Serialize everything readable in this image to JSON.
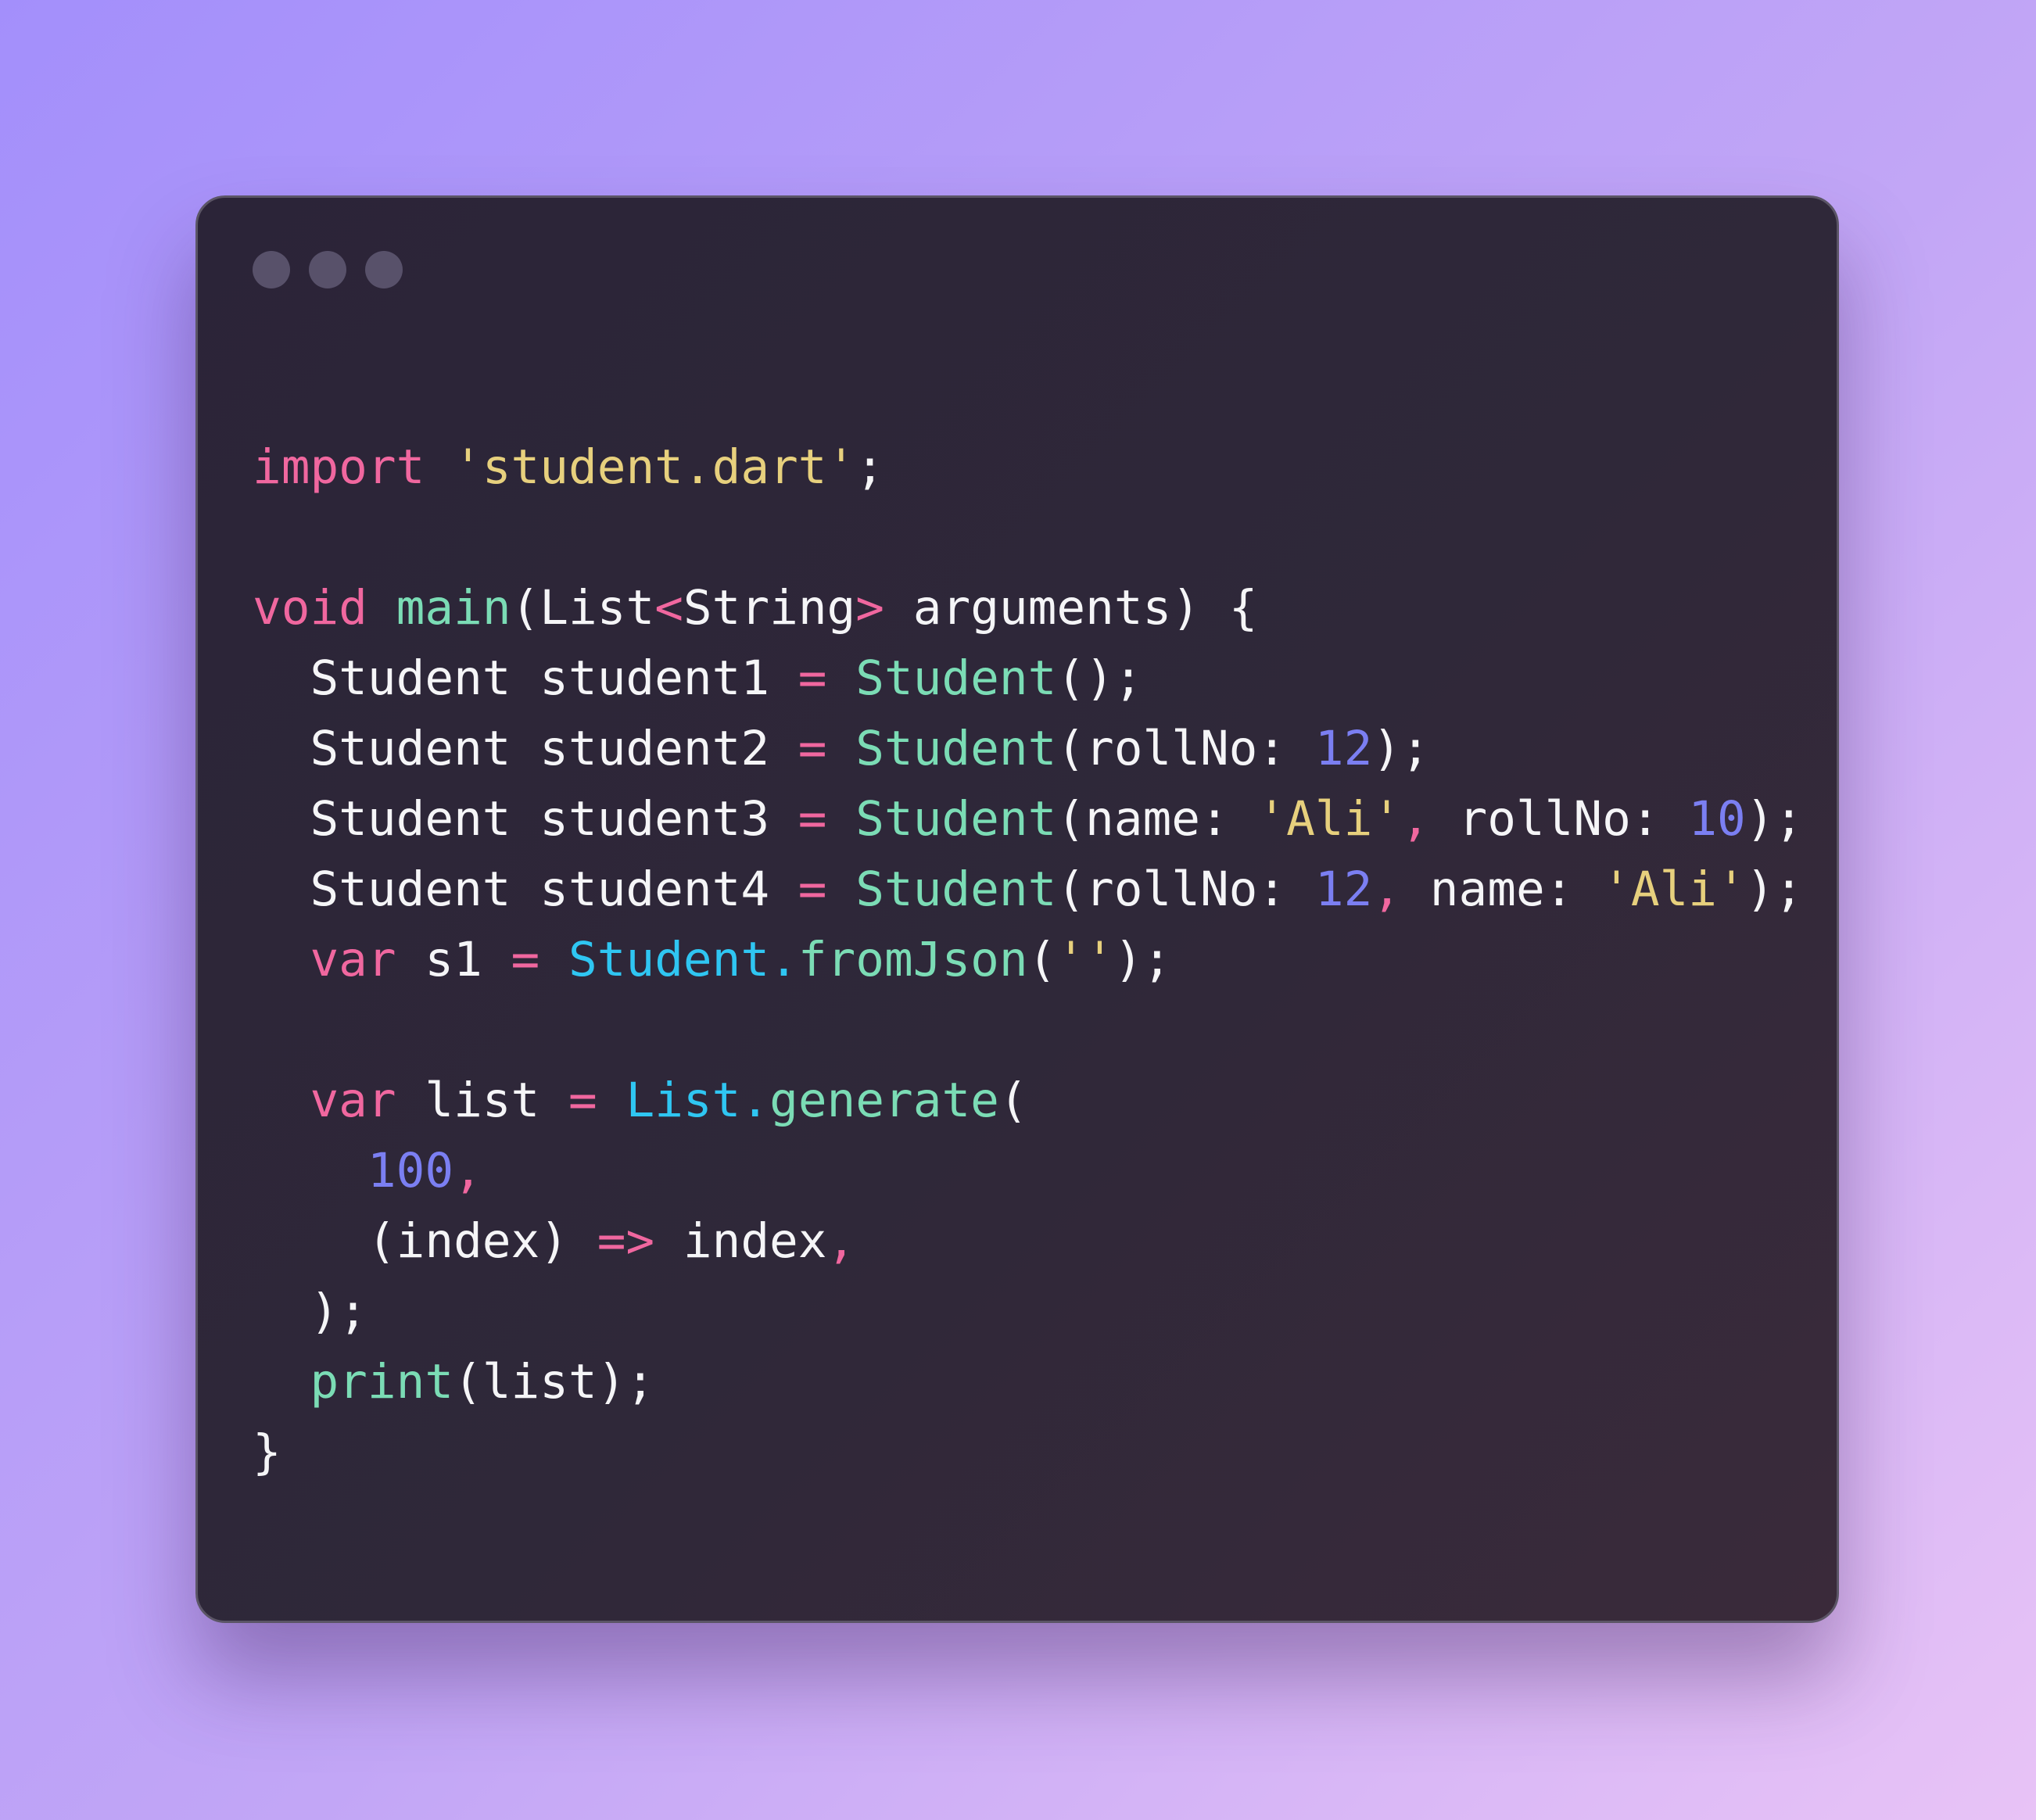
{
  "colors": {
    "keyword": "#f0679f",
    "function": "#7bdcb5",
    "class_ref": "#2fc6f2",
    "string": "#e7d07d",
    "number": "#7b7ff2",
    "plain": "#f5f5f7",
    "window_dot": "#58516a"
  },
  "window": {
    "controls": [
      "window-dot",
      "window-dot",
      "window-dot"
    ]
  },
  "code": {
    "language": "dart",
    "lines": [
      [
        [
          "kw",
          "import"
        ],
        [
          "txt",
          " "
        ],
        [
          "str",
          "'student.dart'"
        ],
        [
          "txt",
          ";"
        ]
      ],
      [],
      [
        [
          "kw",
          "void"
        ],
        [
          "txt",
          " "
        ],
        [
          "fn",
          "main"
        ],
        [
          "txt",
          "(List"
        ],
        [
          "op",
          "<"
        ],
        [
          "txt",
          "String"
        ],
        [
          "op",
          ">"
        ],
        [
          "txt",
          " arguments) {"
        ]
      ],
      [
        [
          "txt",
          "  Student student1 "
        ],
        [
          "op",
          "="
        ],
        [
          "txt",
          " "
        ],
        [
          "fn",
          "Student"
        ],
        [
          "txt",
          "();"
        ]
      ],
      [
        [
          "txt",
          "  Student student2 "
        ],
        [
          "op",
          "="
        ],
        [
          "txt",
          " "
        ],
        [
          "fn",
          "Student"
        ],
        [
          "txt",
          "(rollNo: "
        ],
        [
          "num",
          "12"
        ],
        [
          "txt",
          ");"
        ]
      ],
      [
        [
          "txt",
          "  Student student3 "
        ],
        [
          "op",
          "="
        ],
        [
          "txt",
          " "
        ],
        [
          "fn",
          "Student"
        ],
        [
          "txt",
          "(name: "
        ],
        [
          "str",
          "'Ali'"
        ],
        [
          "op",
          ","
        ],
        [
          "txt",
          " rollNo: "
        ],
        [
          "num",
          "10"
        ],
        [
          "txt",
          ");"
        ]
      ],
      [
        [
          "txt",
          "  Student student4 "
        ],
        [
          "op",
          "="
        ],
        [
          "txt",
          " "
        ],
        [
          "fn",
          "Student"
        ],
        [
          "txt",
          "(rollNo: "
        ],
        [
          "num",
          "12"
        ],
        [
          "op",
          ","
        ],
        [
          "txt",
          " name: "
        ],
        [
          "str",
          "'Ali'"
        ],
        [
          "txt",
          ");"
        ]
      ],
      [
        [
          "txt",
          "  "
        ],
        [
          "kw",
          "var"
        ],
        [
          "txt",
          " s1 "
        ],
        [
          "op",
          "="
        ],
        [
          "txt",
          " "
        ],
        [
          "cls",
          "Student."
        ],
        [
          "fn",
          "fromJson"
        ],
        [
          "txt",
          "("
        ],
        [
          "str",
          "''"
        ],
        [
          "txt",
          ");"
        ]
      ],
      [],
      [
        [
          "txt",
          "  "
        ],
        [
          "kw",
          "var"
        ],
        [
          "txt",
          " list "
        ],
        [
          "op",
          "="
        ],
        [
          "txt",
          " "
        ],
        [
          "cls",
          "List."
        ],
        [
          "fn",
          "generate"
        ],
        [
          "txt",
          "("
        ]
      ],
      [
        [
          "txt",
          "    "
        ],
        [
          "num",
          "100"
        ],
        [
          "op",
          ","
        ]
      ],
      [
        [
          "txt",
          "    (index) "
        ],
        [
          "op",
          "=>"
        ],
        [
          "txt",
          " index"
        ],
        [
          "op",
          ","
        ]
      ],
      [
        [
          "txt",
          "  );"
        ]
      ],
      [
        [
          "txt",
          "  "
        ],
        [
          "fn",
          "print"
        ],
        [
          "txt",
          "(list);"
        ]
      ],
      [
        [
          "txt",
          "}"
        ]
      ]
    ]
  }
}
